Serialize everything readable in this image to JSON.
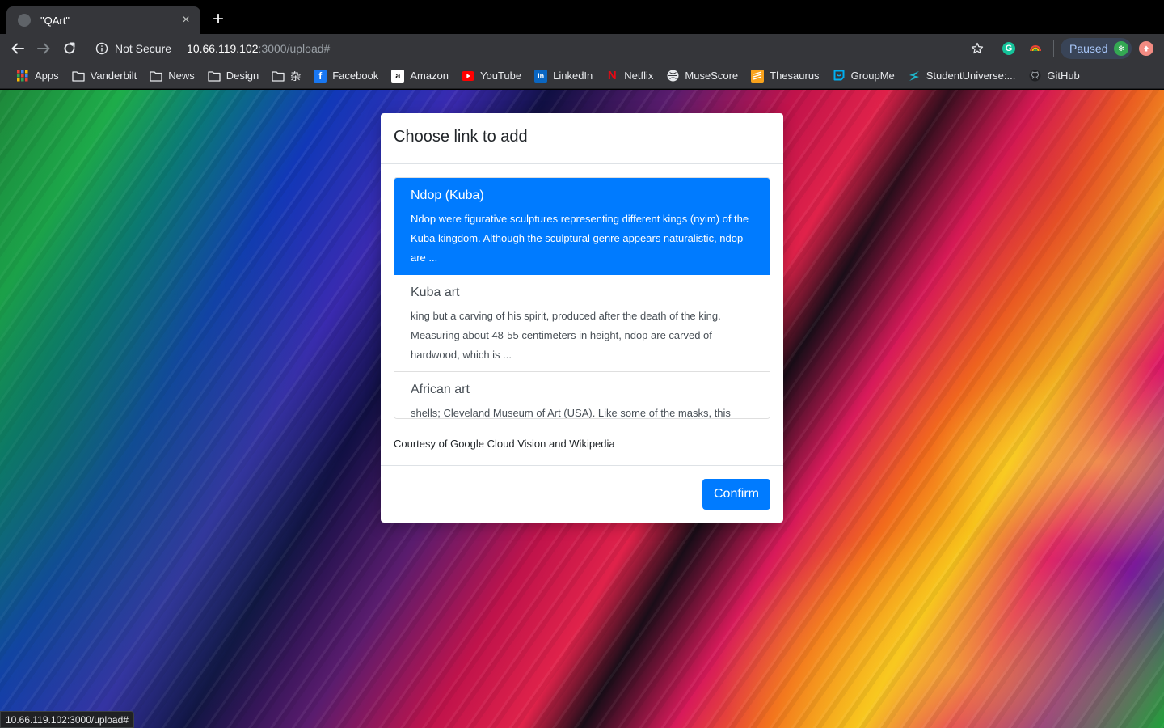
{
  "tab": {
    "title": "\"QArt\"",
    "close_glyph": "×",
    "new_tab_glyph": "+"
  },
  "toolbar": {
    "security_label": "Not Secure",
    "url_host": "10.66.119.102",
    "url_rest": ":3000/upload#",
    "profile_label": "Paused",
    "grammarly_glyph": "G"
  },
  "bookmarks": [
    {
      "label": "Apps",
      "icon": "apps-grid-icon"
    },
    {
      "label": "Vanderbilt",
      "icon": "folder-icon"
    },
    {
      "label": "News",
      "icon": "folder-icon"
    },
    {
      "label": "Design",
      "icon": "folder-icon"
    },
    {
      "label": "杂",
      "icon": "folder-icon"
    },
    {
      "label": "Facebook",
      "icon": "facebook-icon"
    },
    {
      "label": "Amazon",
      "icon": "amazon-icon"
    },
    {
      "label": "YouTube",
      "icon": "youtube-icon"
    },
    {
      "label": "LinkedIn",
      "icon": "linkedin-icon"
    },
    {
      "label": "Netflix",
      "icon": "netflix-icon"
    },
    {
      "label": "MuseScore",
      "icon": "musescore-icon"
    },
    {
      "label": "Thesaurus",
      "icon": "thesaurus-icon"
    },
    {
      "label": "GroupMe",
      "icon": "groupme-icon"
    },
    {
      "label": "StudentUniverse:...",
      "icon": "studentuniverse-icon"
    },
    {
      "label": "GitHub",
      "icon": "github-icon"
    }
  ],
  "modal": {
    "title": "Choose link to add",
    "results": [
      {
        "title": "Ndop (Kuba)",
        "snippet": "Ndop were figurative sculptures representing different kings (nyim) of the Kuba kingdom. Although the sculptural genre appears naturalistic, ndop are ...",
        "selected": true
      },
      {
        "title": "Kuba art",
        "snippet": "king but a carving of his spirit, produced after the death of the king. Measuring about 48-55 centimeters in height, ndop are carved of hardwood, which is ...",
        "selected": false
      },
      {
        "title": "African art",
        "snippet": "shells; Cleveland Museum of Art (USA). Like some of the masks, this",
        "selected": false
      }
    ],
    "credit": "Courtesy of Google Cloud Vision and Wikipedia",
    "confirm_label": "Confirm"
  },
  "status_url": "10.66.119.102:3000/upload#",
  "colors": {
    "accent": "#007bff",
    "chrome": "#35363a",
    "tabstrip": "#000000"
  }
}
